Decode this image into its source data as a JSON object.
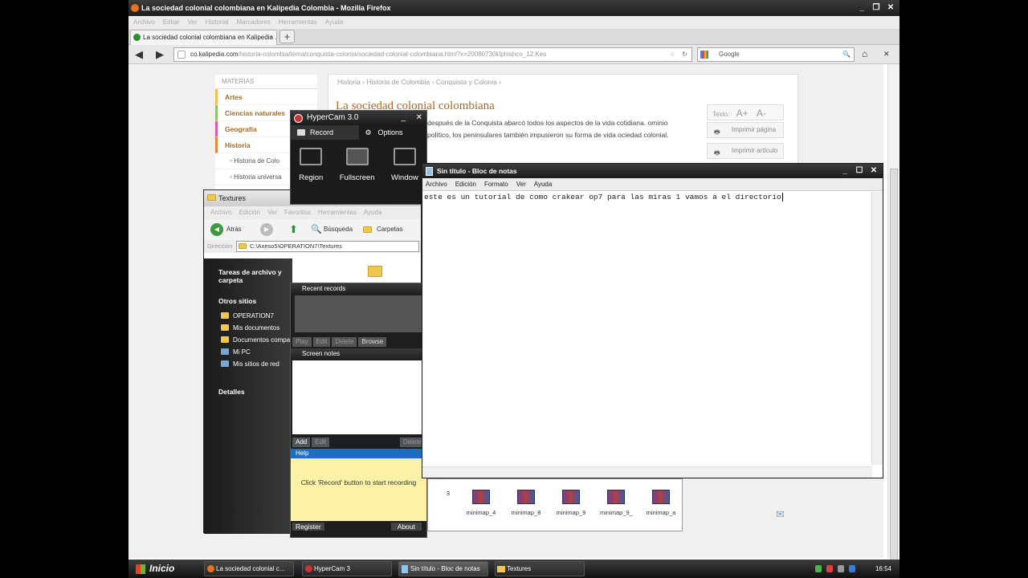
{
  "firefox": {
    "title": "La sociedad colonial colombiana en Kalipedia Colombia - Mozilla Firefox",
    "menu": [
      "Archivo",
      "Editar",
      "Ver",
      "Historial",
      "Marcadores",
      "Herramientas",
      "Ayuda"
    ],
    "tab": "La sociedad colonial colombiana en Kalipedia ...",
    "url_domain": "co.kalipedia.com",
    "url_path": "/historia-colombia/tema/conquista-colonia/sociedad-colonial-colombiana.html?x=20080730klphishco_12.Kes",
    "search": "Google"
  },
  "webpage": {
    "materias_title": "MATERIAS",
    "materias": [
      {
        "label": "Artes",
        "color": "#f2c14e"
      },
      {
        "label": "Ciencias naturales",
        "color": "#8fc46a"
      },
      {
        "label": "Geografía",
        "color": "#d35fa0"
      },
      {
        "label": "Historia",
        "color": "#e08a3c"
      }
    ],
    "sub": [
      "Historia de Colo",
      "Historia universa"
    ],
    "crumbs": "Historia  ›  Historia de Colombia  ›  Conquista y Colonia  ›",
    "title": "La sociedad colonial colombiana",
    "text": "después de la Conquista abarcó todos los aspectos de la vida cotidiana. ominio político, los peninsulares también impusieron su forma de vida ociedad colonial.",
    "tools": {
      "text_label": "Texto:",
      "a_plus": "A+",
      "a_minus": "A-",
      "print_page": "Imprimir página",
      "print_article": "Imprimir artículo"
    }
  },
  "hypercam": {
    "title": "HyperCam 3.0",
    "tab_record": "Record",
    "tab_options": "Options",
    "modes": [
      "Region",
      "Fullscreen",
      "Window"
    ],
    "recent": "Recent records",
    "btn_play": "Play",
    "btn_edit": "Edit",
    "btn_delete": "Delete",
    "btn_browse": "Browse",
    "notes": "Screen notes",
    "btn_add": "Add",
    "help": "Help",
    "help_text": "Click 'Record' button to start recording",
    "register": "Register",
    "about": "About"
  },
  "explorer": {
    "title": "Textures",
    "menu": [
      "Archivo",
      "Edición",
      "Ver",
      "Favoritos",
      "Herramientas",
      "Ayuda"
    ],
    "back": "Atrás",
    "search": "Búsqueda",
    "folders": "Carpetas",
    "addr_label": "Dirección",
    "addr": "C:\\Axeso5\\OPERATION7\\Textures",
    "tasks": "Tareas de archivo y carpeta",
    "other": "Otros sitios",
    "places": [
      "OPERATION7",
      "Mis documentos",
      "Documentos compa",
      "Mi PC",
      "Mis sitios de red"
    ],
    "details": "Detalles",
    "files": [
      "3",
      "minimap_4",
      "minimap_8",
      "minimap_9",
      "minimap_9_",
      "minimap_a"
    ]
  },
  "notepad": {
    "title": "Sin título - Bloc de notas",
    "menu": [
      "Archivo",
      "Edición",
      "Formato",
      "Ver",
      "Ayuda"
    ],
    "content": "este es un tutorial de como crakear op7 para las miras 1 vamos a el directorio"
  },
  "taskbar": {
    "start": "Inicio",
    "items": [
      "La sociedad colonial c...",
      "HyperCam 3",
      "Sin título - Bloc de notas",
      "Textures"
    ],
    "clock": "16:54"
  }
}
